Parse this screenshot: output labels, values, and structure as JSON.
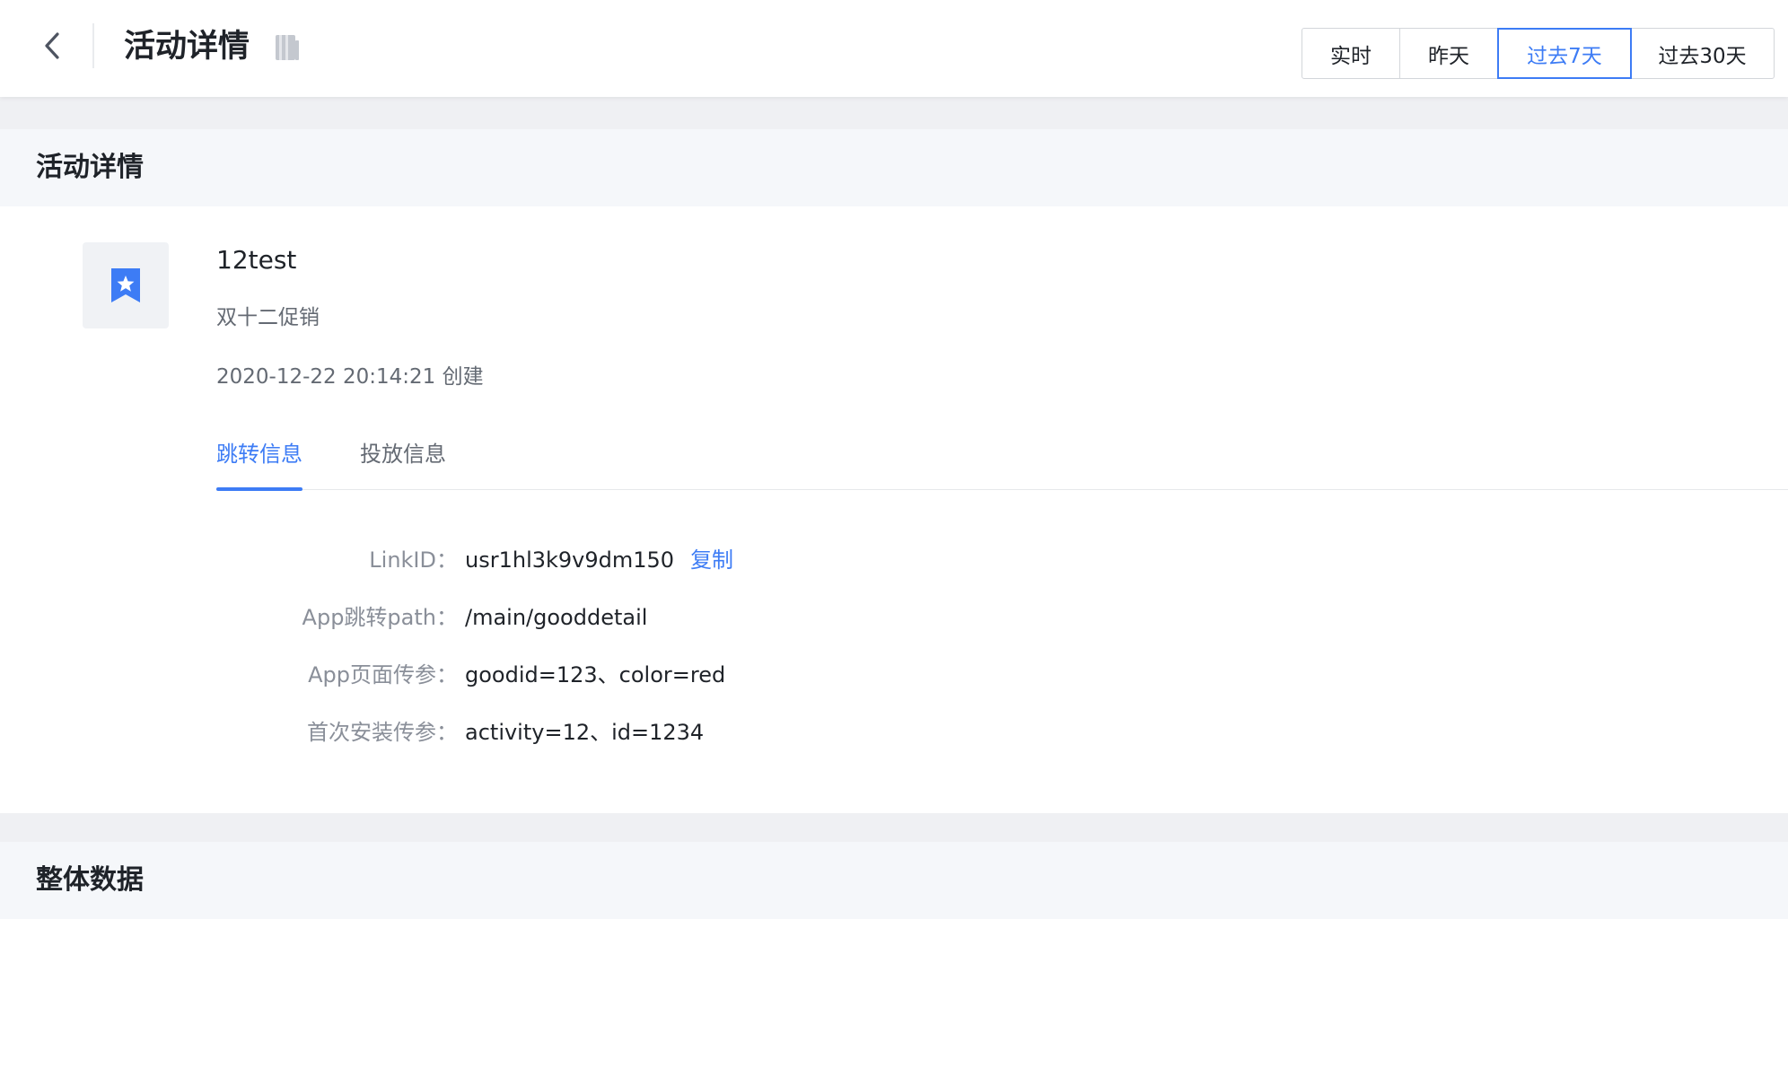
{
  "header": {
    "title": "活动详情",
    "ranges": [
      "实时",
      "昨天",
      "过去7天",
      "过去30天"
    ],
    "active_range_index": 2
  },
  "details_section": {
    "title": "活动详情"
  },
  "activity": {
    "name": "12test",
    "description": "双十二促销",
    "created_text": "2020-12-22 20:14:21 创建"
  },
  "tabs": {
    "items": [
      "跳转信息",
      "投放信息"
    ],
    "active_index": 0
  },
  "jump_info": {
    "link_id_label": "LinkID：",
    "link_id_value": "usr1hl3k9v9dm150",
    "copy_label": "复制",
    "path_label": "App跳转path：",
    "path_value": "/main/gooddetail",
    "page_params_label": "App页面传参：",
    "page_params_value": "goodid=123、color=red",
    "install_params_label": "首次安装传参：",
    "install_params_value": "activity=12、id=1234"
  },
  "overall_section": {
    "title": "整体数据"
  },
  "colors": {
    "accent": "#3d7cf5",
    "text_primary": "#1f2329",
    "text_secondary": "#646a73",
    "section_bg": "#f5f7fa",
    "gap_bg": "#eff0f3"
  }
}
